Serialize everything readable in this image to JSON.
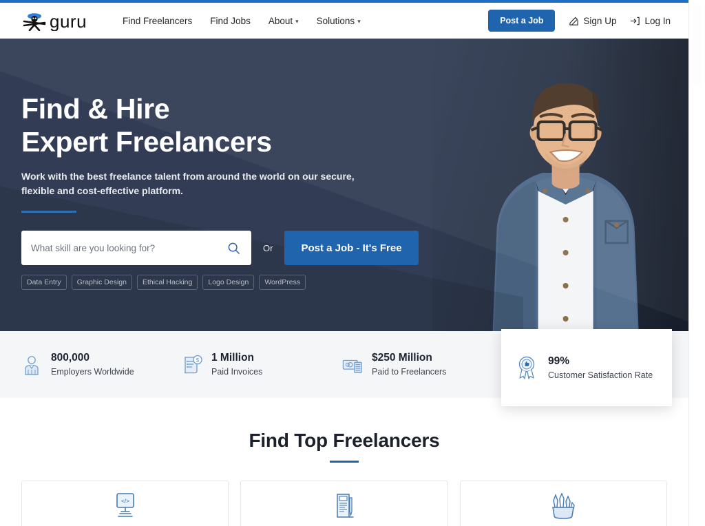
{
  "brand": {
    "name": "guru",
    "accent_blue": "#1f64ad",
    "hero_navy": "#323d55"
  },
  "header": {
    "nav": [
      {
        "label": "Find Freelancers",
        "has_caret": false
      },
      {
        "label": "Find Jobs",
        "has_caret": false
      },
      {
        "label": "About",
        "has_caret": true
      },
      {
        "label": "Solutions",
        "has_caret": true
      }
    ],
    "post_job_label": "Post a Job",
    "sign_up_label": "Sign Up",
    "log_in_label": "Log In",
    "sign_up_icon": "edit-pencil-icon",
    "log_in_icon": "sign-in-arrow-icon"
  },
  "hero": {
    "title_line1": "Find & Hire",
    "title_line2": "Expert Freelancers",
    "subtitle_line1": "Work with the best freelance talent from around the world on our secure,",
    "subtitle_line2": "flexible and cost-effective platform.",
    "search_placeholder": "What skill are you looking for?",
    "search_value": "",
    "search_icon": "search-icon",
    "or_label": "Or",
    "cta_label": "Post a Job - It's Free",
    "tags": [
      "Data Entry",
      "Graphic Design",
      "Ethical Hacking",
      "Logo Design",
      "WordPress"
    ],
    "photo_alt": "smiling man with glasses in denim shirt"
  },
  "stats": [
    {
      "value": "800,000",
      "label": "Employers Worldwide",
      "icon": "employer-person-icon"
    },
    {
      "value": "1 Million",
      "label": "Paid Invoices",
      "icon": "invoice-dollar-icon"
    },
    {
      "value": "$250 Million",
      "label": "Paid to Freelancers",
      "icon": "cash-money-icon"
    }
  ],
  "stat_card": {
    "value": "99%",
    "label": "Customer Satisfaction Rate",
    "icon": "award-ribbon-thumbsup-icon"
  },
  "freelancers_section": {
    "title": "Find Top Freelancers",
    "cards": [
      {
        "icon": "monitor-code-icon",
        "name": "programming-development-card"
      },
      {
        "icon": "document-design-icon",
        "name": "design-art-card"
      },
      {
        "icon": "art-brushes-icon",
        "name": "writing-translation-card"
      }
    ]
  }
}
